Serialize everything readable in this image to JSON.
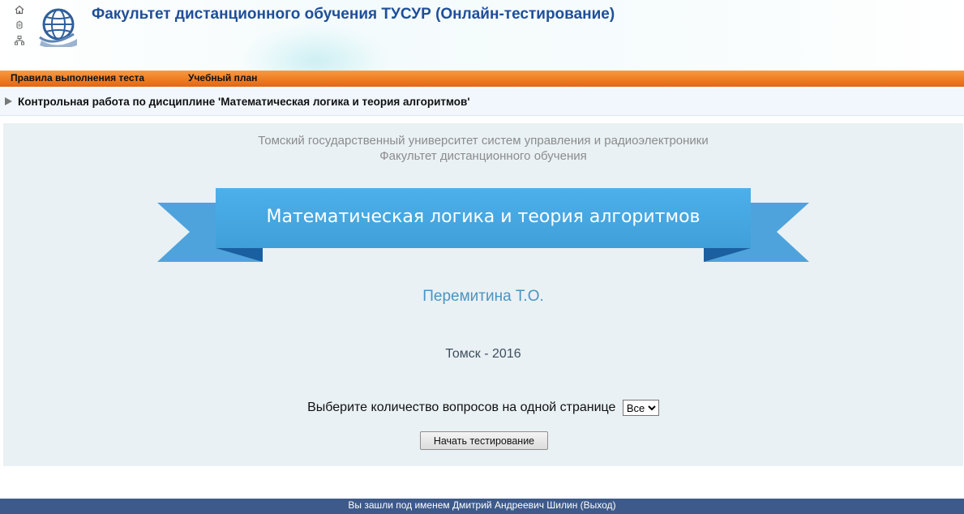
{
  "header": {
    "title": "Факультет дистанционного обучения ТУСУР (Онлайн-тестирование)",
    "icons": [
      "home-icon",
      "contact-icon",
      "sitemap-icon"
    ],
    "logo": "globe-logo"
  },
  "menu": {
    "items": [
      {
        "label": "Правила выполнения теста"
      },
      {
        "label": "Учебный план"
      }
    ]
  },
  "breadcrumb": {
    "text": "Контрольная работа по дисциплине 'Математическая логика и теория алгоритмов'"
  },
  "main": {
    "university_line1": "Томский государственный университет систем управления и радиоэлектроники",
    "university_line2": "Факультет дистанционного обучения",
    "course_title": "Математическая логика и теория алгоритмов",
    "author": "Перемитина Т.О.",
    "city_year": "Томск - 2016",
    "questions_label": "Выберите количество вопросов на одной странице",
    "questions_selected": "Все",
    "start_button": "Начать тестирование"
  },
  "footer": {
    "prefix": "Вы зашли под именем Дмитрий Андреевич Шилин (",
    "exit_link": "Выход",
    "suffix": ")"
  },
  "colors": {
    "title_blue": "#1f4f9a",
    "menu_orange": "#ee7a1f",
    "ribbon_blue": "#47a8e3",
    "ribbon_dark": "#1a5fa0",
    "author_blue": "#4a95c2",
    "footer_blue": "#3d5a8a",
    "panel_bg": "#e9f1f4"
  }
}
